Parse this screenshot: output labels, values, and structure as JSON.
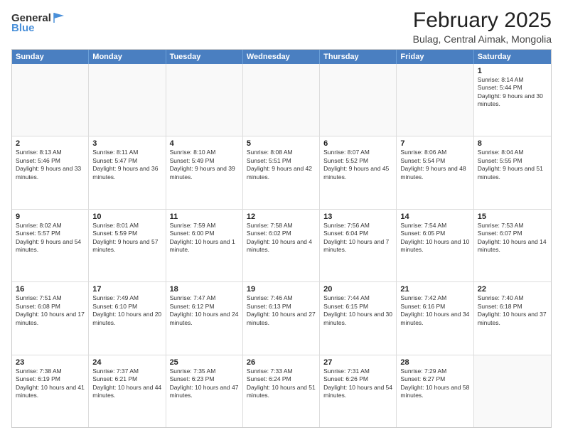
{
  "header": {
    "logo": {
      "general": "General",
      "blue": "Blue"
    },
    "title": "February 2025",
    "subtitle": "Bulag, Central Aimak, Mongolia"
  },
  "calendar": {
    "days_of_week": [
      "Sunday",
      "Monday",
      "Tuesday",
      "Wednesday",
      "Thursday",
      "Friday",
      "Saturday"
    ],
    "rows": [
      {
        "cells": [
          {
            "day": "",
            "empty": true
          },
          {
            "day": "",
            "empty": true
          },
          {
            "day": "",
            "empty": true
          },
          {
            "day": "",
            "empty": true
          },
          {
            "day": "",
            "empty": true
          },
          {
            "day": "",
            "empty": true
          },
          {
            "day": "1",
            "sunrise": "Sunrise: 8:14 AM",
            "sunset": "Sunset: 5:44 PM",
            "daylight": "Daylight: 9 hours and 30 minutes."
          }
        ]
      },
      {
        "cells": [
          {
            "day": "2",
            "sunrise": "Sunrise: 8:13 AM",
            "sunset": "Sunset: 5:46 PM",
            "daylight": "Daylight: 9 hours and 33 minutes."
          },
          {
            "day": "3",
            "sunrise": "Sunrise: 8:11 AM",
            "sunset": "Sunset: 5:47 PM",
            "daylight": "Daylight: 9 hours and 36 minutes."
          },
          {
            "day": "4",
            "sunrise": "Sunrise: 8:10 AM",
            "sunset": "Sunset: 5:49 PM",
            "daylight": "Daylight: 9 hours and 39 minutes."
          },
          {
            "day": "5",
            "sunrise": "Sunrise: 8:08 AM",
            "sunset": "Sunset: 5:51 PM",
            "daylight": "Daylight: 9 hours and 42 minutes."
          },
          {
            "day": "6",
            "sunrise": "Sunrise: 8:07 AM",
            "sunset": "Sunset: 5:52 PM",
            "daylight": "Daylight: 9 hours and 45 minutes."
          },
          {
            "day": "7",
            "sunrise": "Sunrise: 8:06 AM",
            "sunset": "Sunset: 5:54 PM",
            "daylight": "Daylight: 9 hours and 48 minutes."
          },
          {
            "day": "8",
            "sunrise": "Sunrise: 8:04 AM",
            "sunset": "Sunset: 5:55 PM",
            "daylight": "Daylight: 9 hours and 51 minutes."
          }
        ]
      },
      {
        "cells": [
          {
            "day": "9",
            "sunrise": "Sunrise: 8:02 AM",
            "sunset": "Sunset: 5:57 PM",
            "daylight": "Daylight: 9 hours and 54 minutes."
          },
          {
            "day": "10",
            "sunrise": "Sunrise: 8:01 AM",
            "sunset": "Sunset: 5:59 PM",
            "daylight": "Daylight: 9 hours and 57 minutes."
          },
          {
            "day": "11",
            "sunrise": "Sunrise: 7:59 AM",
            "sunset": "Sunset: 6:00 PM",
            "daylight": "Daylight: 10 hours and 1 minute."
          },
          {
            "day": "12",
            "sunrise": "Sunrise: 7:58 AM",
            "sunset": "Sunset: 6:02 PM",
            "daylight": "Daylight: 10 hours and 4 minutes."
          },
          {
            "day": "13",
            "sunrise": "Sunrise: 7:56 AM",
            "sunset": "Sunset: 6:04 PM",
            "daylight": "Daylight: 10 hours and 7 minutes."
          },
          {
            "day": "14",
            "sunrise": "Sunrise: 7:54 AM",
            "sunset": "Sunset: 6:05 PM",
            "daylight": "Daylight: 10 hours and 10 minutes."
          },
          {
            "day": "15",
            "sunrise": "Sunrise: 7:53 AM",
            "sunset": "Sunset: 6:07 PM",
            "daylight": "Daylight: 10 hours and 14 minutes."
          }
        ]
      },
      {
        "cells": [
          {
            "day": "16",
            "sunrise": "Sunrise: 7:51 AM",
            "sunset": "Sunset: 6:08 PM",
            "daylight": "Daylight: 10 hours and 17 minutes."
          },
          {
            "day": "17",
            "sunrise": "Sunrise: 7:49 AM",
            "sunset": "Sunset: 6:10 PM",
            "daylight": "Daylight: 10 hours and 20 minutes."
          },
          {
            "day": "18",
            "sunrise": "Sunrise: 7:47 AM",
            "sunset": "Sunset: 6:12 PM",
            "daylight": "Daylight: 10 hours and 24 minutes."
          },
          {
            "day": "19",
            "sunrise": "Sunrise: 7:46 AM",
            "sunset": "Sunset: 6:13 PM",
            "daylight": "Daylight: 10 hours and 27 minutes."
          },
          {
            "day": "20",
            "sunrise": "Sunrise: 7:44 AM",
            "sunset": "Sunset: 6:15 PM",
            "daylight": "Daylight: 10 hours and 30 minutes."
          },
          {
            "day": "21",
            "sunrise": "Sunrise: 7:42 AM",
            "sunset": "Sunset: 6:16 PM",
            "daylight": "Daylight: 10 hours and 34 minutes."
          },
          {
            "day": "22",
            "sunrise": "Sunrise: 7:40 AM",
            "sunset": "Sunset: 6:18 PM",
            "daylight": "Daylight: 10 hours and 37 minutes."
          }
        ]
      },
      {
        "cells": [
          {
            "day": "23",
            "sunrise": "Sunrise: 7:38 AM",
            "sunset": "Sunset: 6:19 PM",
            "daylight": "Daylight: 10 hours and 41 minutes."
          },
          {
            "day": "24",
            "sunrise": "Sunrise: 7:37 AM",
            "sunset": "Sunset: 6:21 PM",
            "daylight": "Daylight: 10 hours and 44 minutes."
          },
          {
            "day": "25",
            "sunrise": "Sunrise: 7:35 AM",
            "sunset": "Sunset: 6:23 PM",
            "daylight": "Daylight: 10 hours and 47 minutes."
          },
          {
            "day": "26",
            "sunrise": "Sunrise: 7:33 AM",
            "sunset": "Sunset: 6:24 PM",
            "daylight": "Daylight: 10 hours and 51 minutes."
          },
          {
            "day": "27",
            "sunrise": "Sunrise: 7:31 AM",
            "sunset": "Sunset: 6:26 PM",
            "daylight": "Daylight: 10 hours and 54 minutes."
          },
          {
            "day": "28",
            "sunrise": "Sunrise: 7:29 AM",
            "sunset": "Sunset: 6:27 PM",
            "daylight": "Daylight: 10 hours and 58 minutes."
          },
          {
            "day": "",
            "empty": true
          }
        ]
      }
    ]
  }
}
